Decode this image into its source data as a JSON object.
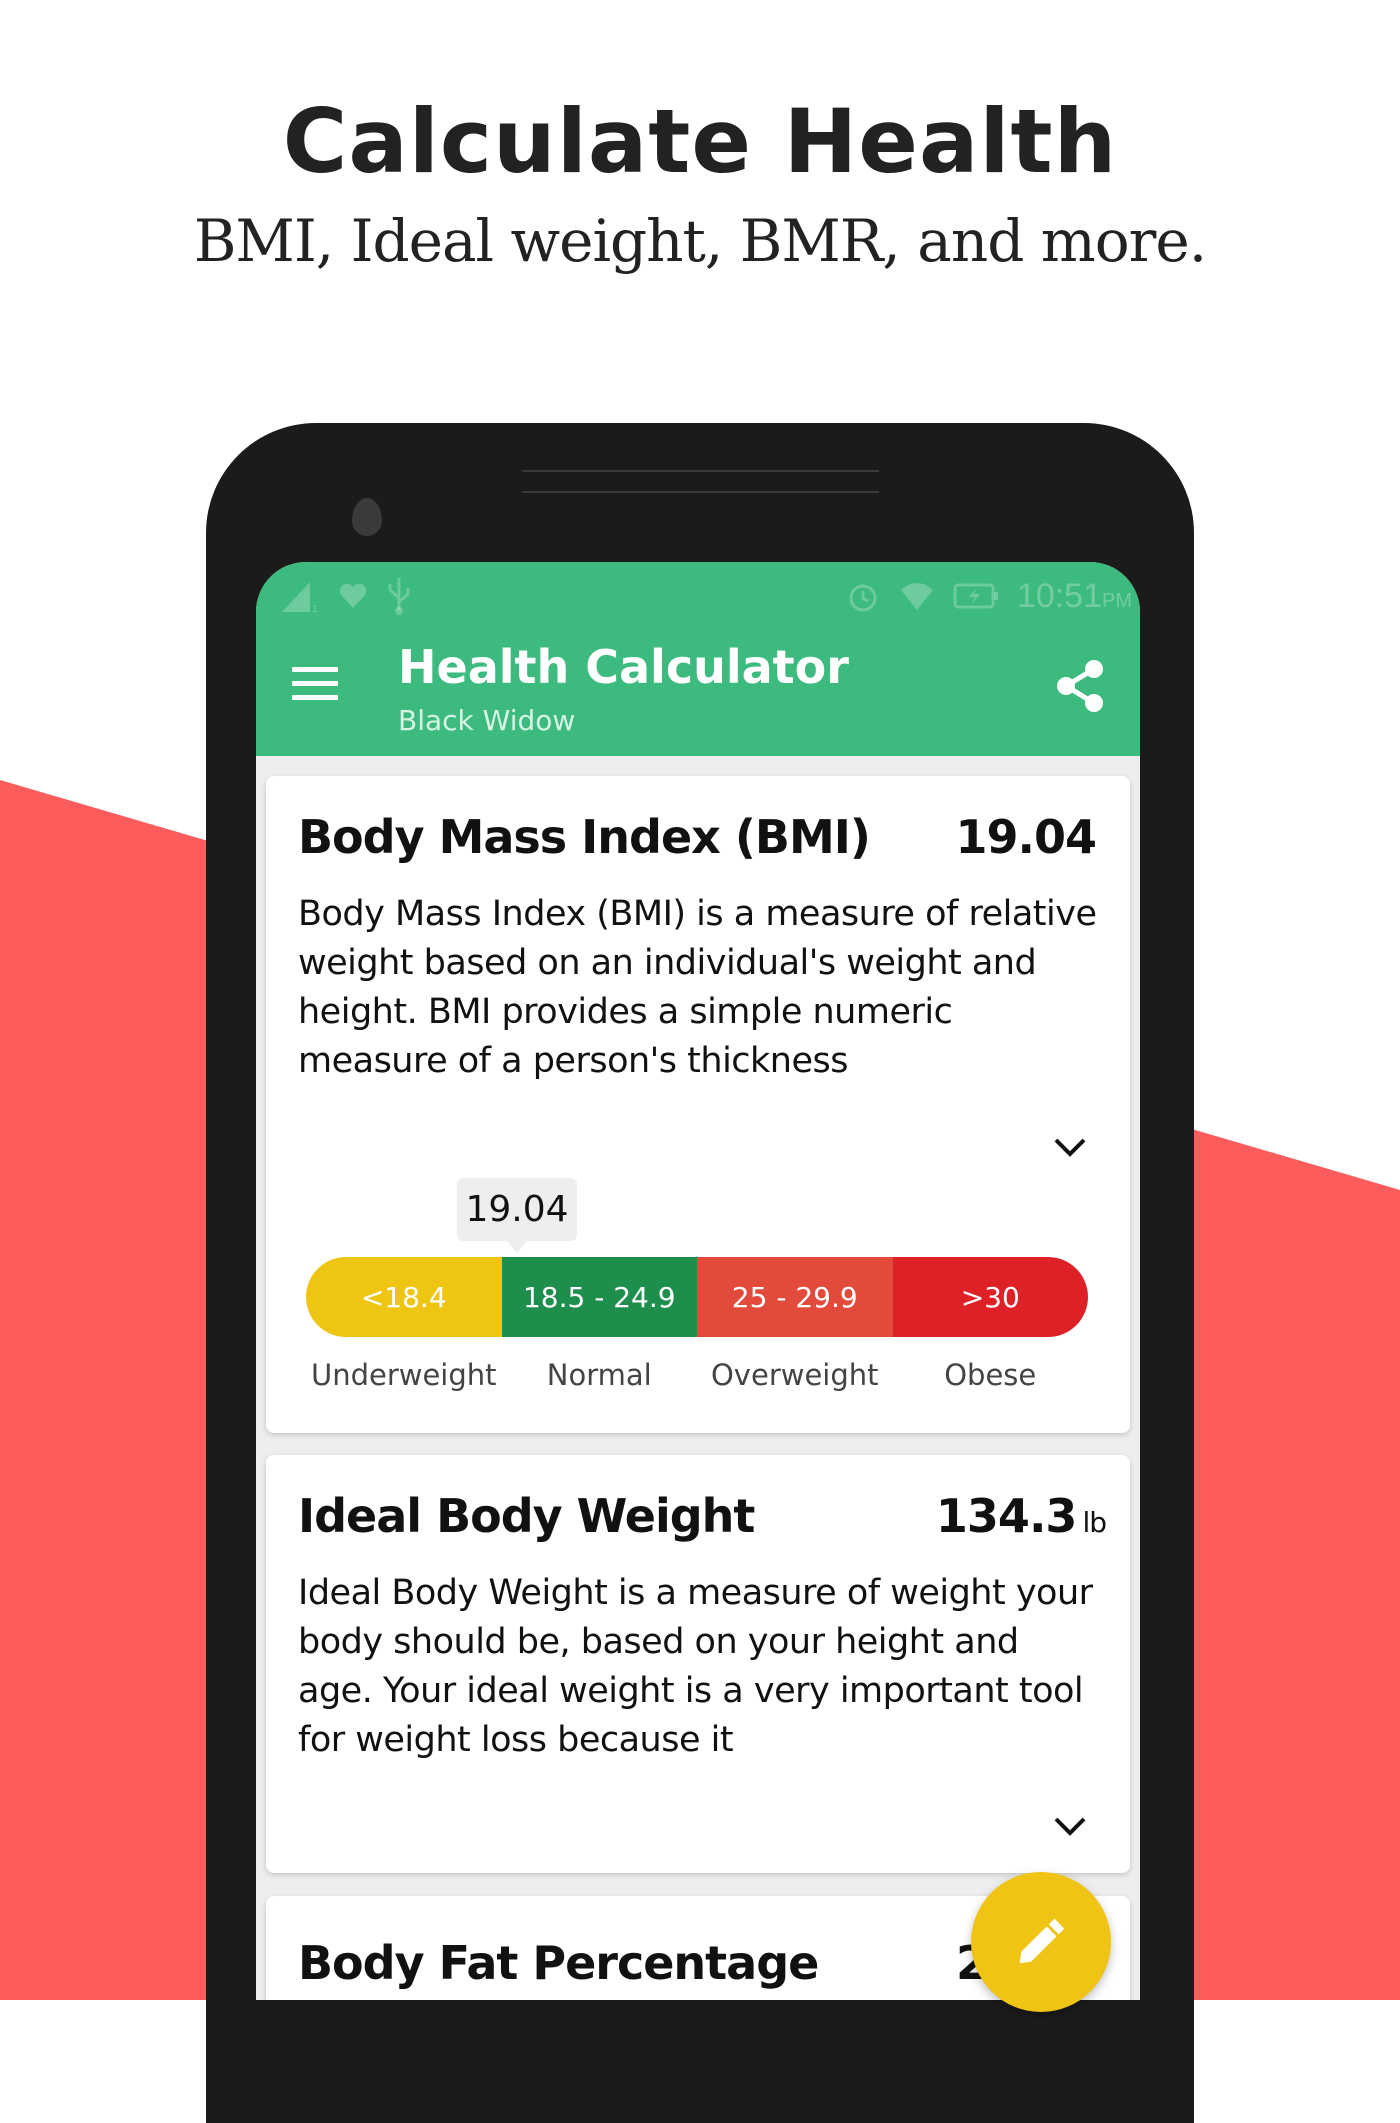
{
  "promo": {
    "title": "Calculate Health",
    "subtitle": "BMI, Ideal weight, BMR, and more."
  },
  "status_bar": {
    "left_icons": [
      "signal-icon",
      "heart-icon",
      "usb-icon"
    ],
    "right_icons": [
      "alarm-icon",
      "wifi-icon",
      "battery-charging-icon"
    ],
    "time": "10:51",
    "ampm": "PM"
  },
  "app_bar": {
    "title": "Health Calculator",
    "subtitle": "Black Widow",
    "menu_icon": "hamburger-menu-icon",
    "action_icon": "share-icon"
  },
  "colors": {
    "primary": "#3dba7e",
    "accent": "#f0c415",
    "background_red": "#fd5c5c"
  },
  "cards": [
    {
      "title": "Body Mass Index (BMI)",
      "value": "19.04",
      "unit": "",
      "description": "Body Mass Index (BMI) is a measure of relative weight based on an individual's weight and height. BMI provides a simple numeric measure of a person's thickness",
      "expand_icon": "chevron-down-icon"
    },
    {
      "title": "Ideal Body Weight",
      "value": "134.3",
      "unit": "lb",
      "description": "Ideal Body Weight is a measure of weight your body should be, based on your height and age. Your ideal weight is a very important tool for weight loss because it",
      "expand_icon": "chevron-down-icon"
    },
    {
      "title": "Body Fat Percentage",
      "value": "2"
    }
  ],
  "bmi_scale": {
    "current": "19.04",
    "segments": [
      {
        "range": "<18.4",
        "label": "Underweight",
        "color": "#efc514"
      },
      {
        "range": "18.5 - 24.9",
        "label": "Normal",
        "color": "#1e8e4c"
      },
      {
        "range": "25 - 29.9",
        "label": "Overweight",
        "color": "#e24b3b"
      },
      {
        "range": ">30",
        "label": "Obese",
        "color": "#de2027"
      }
    ]
  },
  "fab": {
    "icon": "edit-pencil-icon"
  }
}
